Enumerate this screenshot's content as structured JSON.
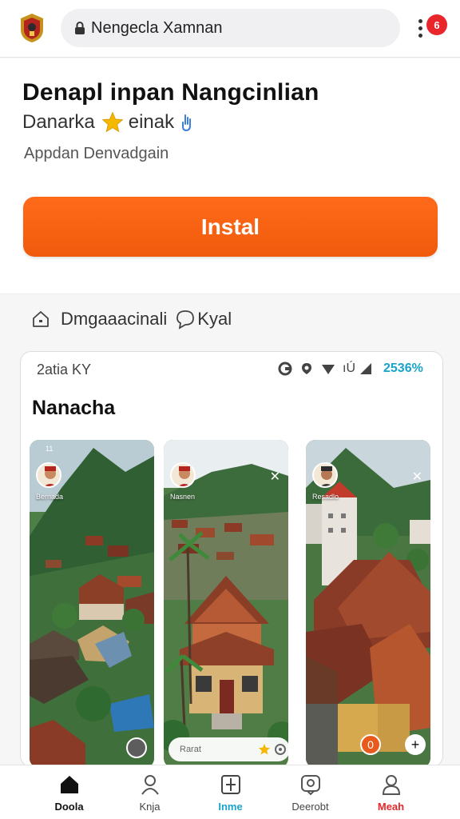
{
  "browser": {
    "url": "Nengecla Xamnan",
    "notification_count": "6"
  },
  "app": {
    "title": "Denapl inpan Nangcinlian",
    "rating_left": "Danarka",
    "rating_right": "einak",
    "developer": "Appdan Denvadgain",
    "install_label": "Instal"
  },
  "info": {
    "label1": "Dmgaaacinali",
    "label2": "Kyal"
  },
  "preview": {
    "status_time": "2atia KY",
    "status_signal": "ıÚ",
    "battery": "2536%",
    "title": "Nanacha",
    "screens": [
      {
        "status": "11",
        "caption": "Bernada"
      },
      {
        "status": "",
        "caption": "Nasnen",
        "pill_text": "Rarat"
      },
      {
        "status": "",
        "caption": "Resadlo",
        "badge": "0"
      }
    ]
  },
  "nav": {
    "items": [
      {
        "label": "Doola",
        "color": "#111111"
      },
      {
        "label": "Knja",
        "color": "#555555"
      },
      {
        "label": "Inme",
        "color": "#1aa3c8"
      },
      {
        "label": "Deerobt",
        "color": "#555555"
      },
      {
        "label": "Meah",
        "color": "#e8262b"
      }
    ]
  },
  "colors": {
    "accent": "#f05a0c",
    "badge": "#e8262b",
    "link": "#1aa3c8"
  }
}
